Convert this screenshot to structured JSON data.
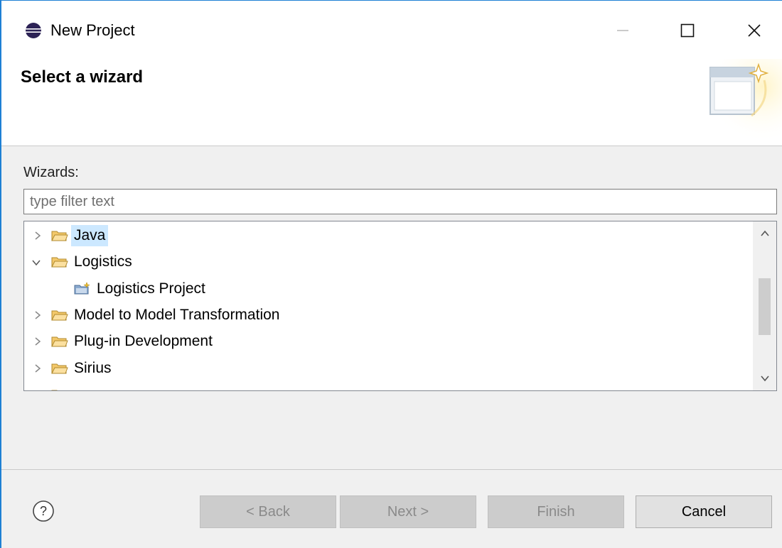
{
  "window": {
    "title": "New Project",
    "icon": "eclipse-icon",
    "controls": [
      "minimize-icon",
      "maximize-icon",
      "close-icon"
    ]
  },
  "banner": {
    "title": "Select a wizard",
    "icon": "new-wizard-icon"
  },
  "wizards": {
    "label": "Wizards:",
    "filter_placeholder": "type filter text",
    "filter_value": "",
    "tree": [
      {
        "label": "Java",
        "icon": "folder-icon",
        "expanded": false,
        "selected": true,
        "depth": 0
      },
      {
        "label": "Logistics",
        "icon": "folder-icon",
        "expanded": true,
        "selected": false,
        "depth": 0
      },
      {
        "label": "Logistics Project",
        "icon": "project-wizard-icon",
        "expanded": null,
        "selected": false,
        "depth": 1
      },
      {
        "label": "Model to Model Transformation",
        "icon": "folder-icon",
        "expanded": false,
        "selected": false,
        "depth": 0
      },
      {
        "label": "Plug-in Development",
        "icon": "folder-icon",
        "expanded": false,
        "selected": false,
        "depth": 0
      },
      {
        "label": "Sirius",
        "icon": "folder-icon",
        "expanded": false,
        "selected": false,
        "depth": 0
      }
    ]
  },
  "footer": {
    "help_icon": "help-icon",
    "buttons": {
      "back": {
        "label": "< Back",
        "enabled": false
      },
      "next": {
        "label": "Next >",
        "enabled": false
      },
      "finish": {
        "label": "Finish",
        "enabled": false
      },
      "cancel": {
        "label": "Cancel",
        "enabled": true
      }
    }
  },
  "colors": {
    "window_border": "#1e80d4",
    "selection": "#cce8ff",
    "folder": "#e8b54a"
  }
}
